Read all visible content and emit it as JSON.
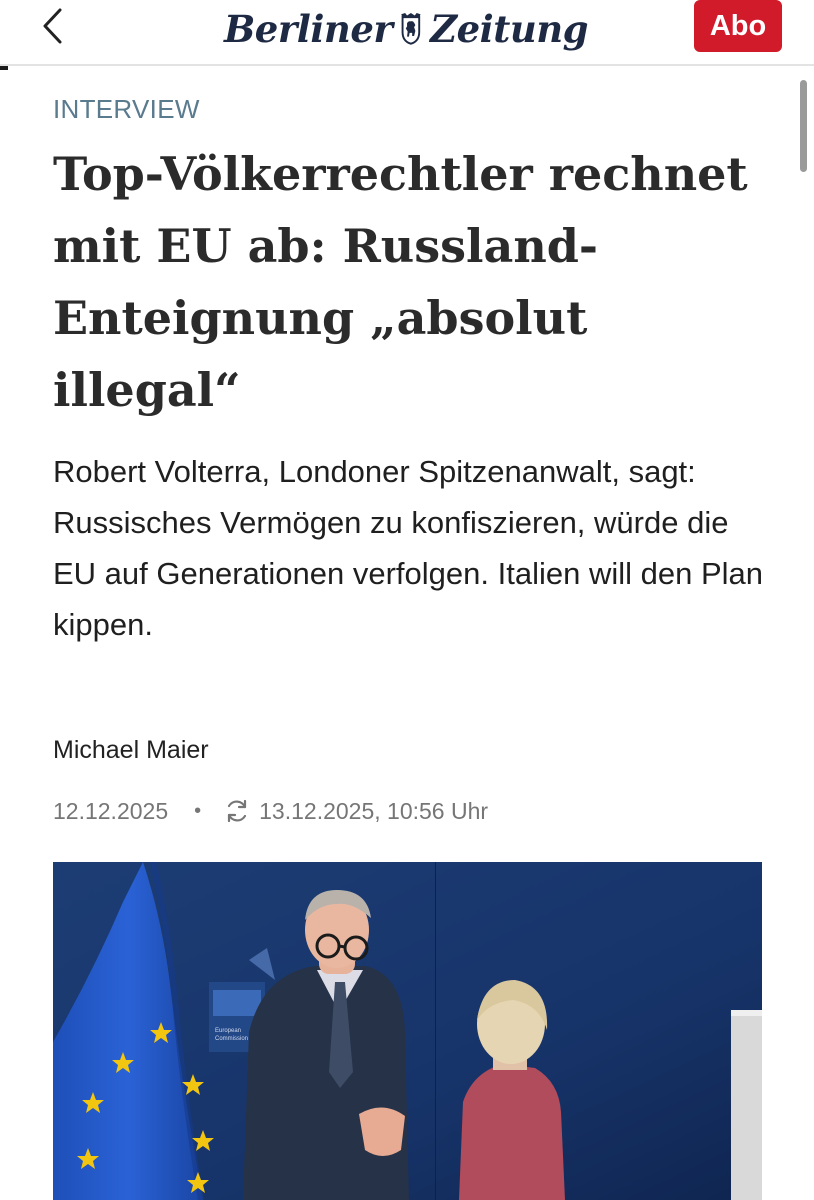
{
  "header": {
    "back_icon": "chevron-left-icon",
    "logo_left": "Berliner",
    "logo_right": "Zeitung",
    "subscribe_label": "Abo",
    "accent_color": "#d11a2a"
  },
  "article": {
    "kicker": "INTERVIEW",
    "headline": "Top-Völkerrechtler rechnet mit EU ab: Russland-Enteignung „absolut illegal“",
    "lead": "Robert Volterra, Londoner Spitzenanwalt, sagt: Russisches Vermögen zu konfiszieren, würde die EU auf Generationen verfolgen. Italien will den Plan kippen.",
    "author": "Michael Maier",
    "published": "12.12.2025",
    "separator": "•",
    "updated_icon": "refresh-icon",
    "updated": "13.12.2025, 10:56 Uhr"
  },
  "photo": {
    "sign_line1": "European",
    "sign_line2": "Commission"
  }
}
